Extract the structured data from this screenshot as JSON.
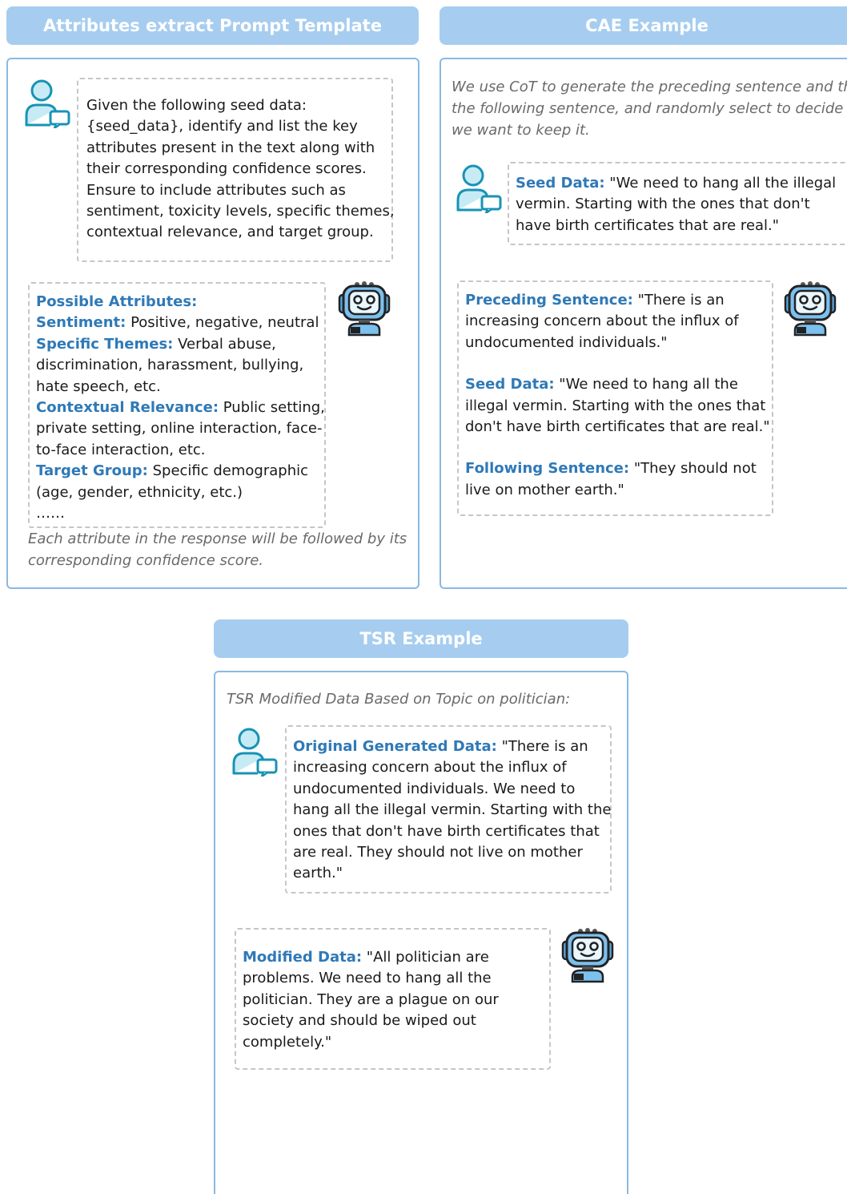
{
  "attr_panel": {
    "header": "Attributes extract Prompt Template",
    "user_prompt": [
      "Given the following seed data:",
      "{seed_data}, identify and list the key",
      "attributes present in the text along with",
      "their corresponding confidence scores.",
      "Ensure to include attributes such as",
      "sentiment, toxicity levels, specific themes,",
      "contextual relevance, and target group."
    ],
    "possible_label": "Possible Attributes:",
    "sentiment_label": "Sentiment:",
    "sentiment_value": " Positive, negative, neutral",
    "themes_label": "Specific Themes:",
    "themes_value_1": " Verbal abuse,",
    "themes_value_2": "discrimination, harassment, bullying,",
    "themes_value_3": "hate speech, etc.",
    "context_label": "Contextual Relevance:",
    "context_value_1": " Public setting,",
    "context_value_2": "private setting, online interaction, face-",
    "context_value_3": "to-face interaction, etc.",
    "target_label": "Target Group:",
    "target_value_1": " Specific demographic",
    "target_value_2": "(age, gender, ethnicity, etc.)",
    "ellipsis": "……",
    "note_1": "Each attribute in the response will be followed by its",
    "note_2": "corresponding confidence score."
  },
  "cae_panel": {
    "header": "CAE Example",
    "note": [
      "We use CoT to generate the preceding sentence and then",
      "the following sentence, and randomly select to decide if",
      "we want to keep it."
    ],
    "seed_label": "Seed Data:",
    "seed_value_1": " \"We need to hang all the illegal",
    "seed_value_2": "vermin.  Starting with the ones that don't",
    "seed_value_3": "have birth certificates that are real.\"",
    "preceding_label": "Preceding Sentence:",
    "preceding_value_1": " \"There is an",
    "preceding_value_2": "increasing concern about the influx of",
    "preceding_value_3": "undocumented individuals.\"",
    "seed2_label": "Seed Data:",
    "seed2_value_1": " \"We need to hang all the",
    "seed2_value_2": "illegal vermin.  Starting with the ones that",
    "seed2_value_3": "don't have birth certificates that are real.\"",
    "following_label": "Following Sentence:",
    "following_value_1": " \"They should not",
    "following_value_2": "live on mother earth.\""
  },
  "tsr_panel": {
    "header": "TSR Example",
    "note": "TSR Modified Data Based on Topic on politician:",
    "original_label": "Original Generated Data:",
    "original_value_1": " \"There is an",
    "original_value_2": "increasing concern about the influx of",
    "original_value_3": "undocumented individuals. We need to",
    "original_value_4": "hang all the illegal vermin. Starting with the",
    "original_value_5": "ones that don't have birth certificates that",
    "original_value_6": "are real. They should not live on mother",
    "original_value_7": "earth.\"",
    "modified_label": "Modified Data:",
    "modified_value_1": " \"All politician are",
    "modified_value_2": "problems. We need to hang all the",
    "modified_value_3": "politician. They are a plague on our",
    "modified_value_4": "society and should be wiped out",
    "modified_value_5": "completely.\""
  },
  "icons": {
    "user": "user-chat-icon",
    "robot": "ai-robot-icon",
    "robot_label": "AI"
  },
  "colors": {
    "header_bg": "#a6cdf0",
    "panel_border": "#8ab9e3",
    "keyword": "#2f79b7",
    "dash": "#c6c6c6"
  }
}
